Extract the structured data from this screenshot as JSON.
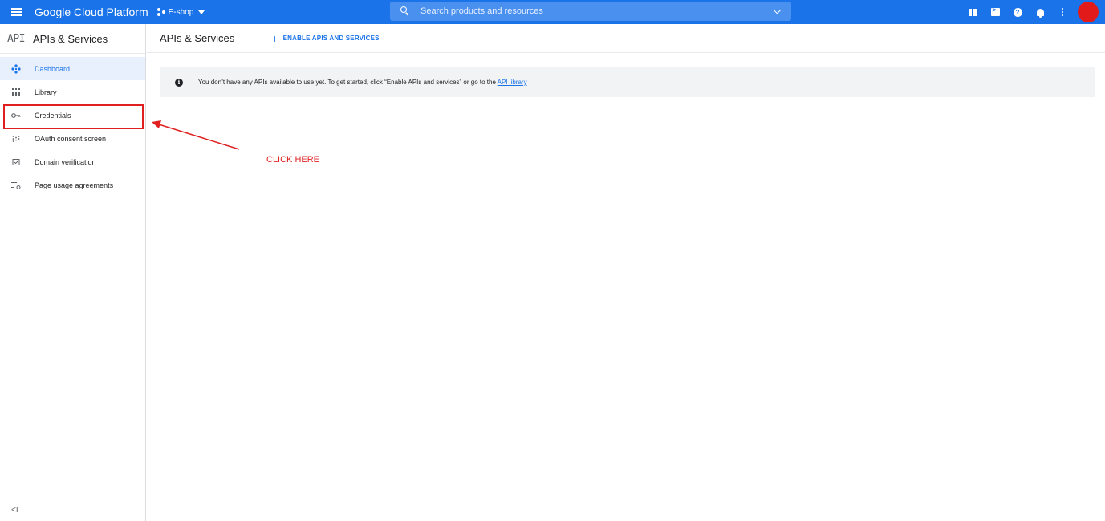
{
  "topbar": {
    "brand": "Google Cloud Platform",
    "project": "E-shop",
    "search_placeholder": "Search products and resources",
    "accent_color": "#1a73e8",
    "icons": [
      "menu-icon",
      "gift-icon",
      "cloud-shell-icon",
      "help-icon",
      "notifications-icon",
      "more-vert-icon",
      "avatar"
    ]
  },
  "sidebar": {
    "logo": "API",
    "title": "APIs & Services",
    "items": [
      {
        "label": "Dashboard",
        "icon": "dashboard-icon",
        "active": true
      },
      {
        "label": "Library",
        "icon": "library-icon",
        "active": false
      },
      {
        "label": "Credentials",
        "icon": "key-icon",
        "active": false
      },
      {
        "label": "OAuth consent screen",
        "icon": "oauth-icon",
        "active": false
      },
      {
        "label": "Domain verification",
        "icon": "domain-icon",
        "active": false
      },
      {
        "label": "Page usage agreements",
        "icon": "settings-list-icon",
        "active": false
      }
    ],
    "collapse": "<I"
  },
  "main": {
    "title": "APIs & Services",
    "enable_button": "ENABLE APIS AND SERVICES",
    "banner_text": "You don’t have any APIs available to use yet. To get started, click “Enable APIs and services” or go to the",
    "banner_link": "API library"
  },
  "annotation": {
    "text": "CLICK HERE",
    "color": "#e02020"
  }
}
